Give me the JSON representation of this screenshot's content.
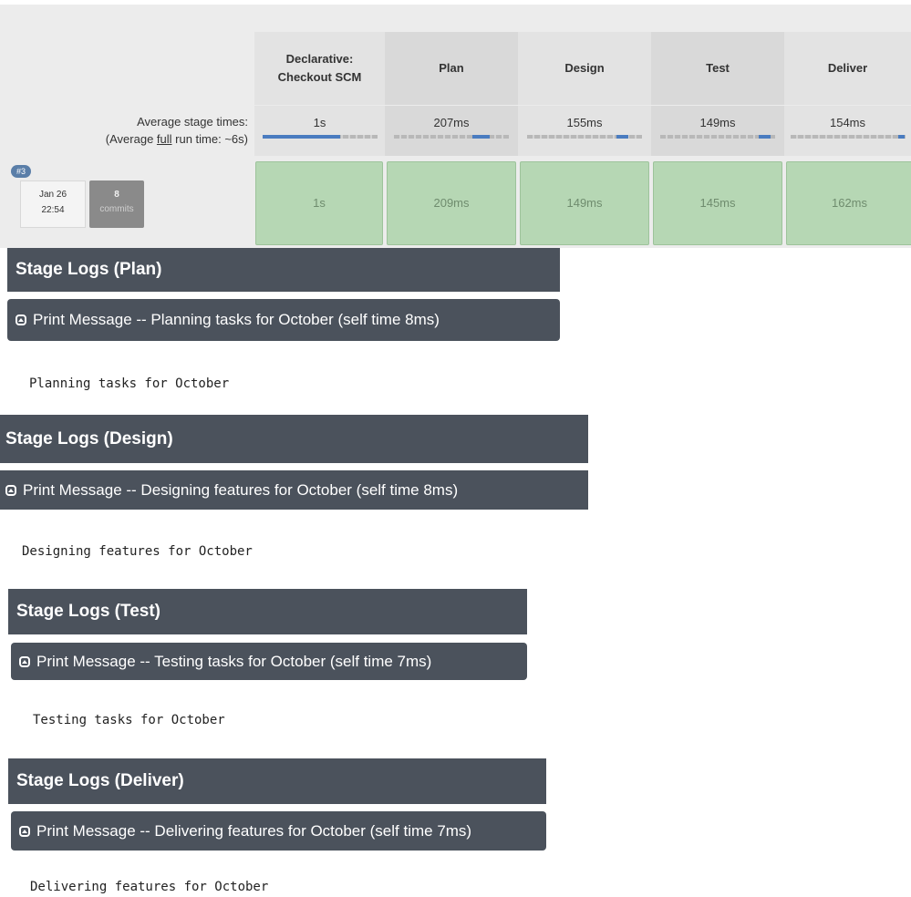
{
  "stage_view": {
    "columns": [
      {
        "name": "Declarative: Checkout SCM",
        "avg": "1s",
        "run": "1s",
        "bar_fill": 0.68
      },
      {
        "name": "Plan",
        "avg": "207ms",
        "run": "209ms",
        "bar_fill": 0.15
      },
      {
        "name": "Design",
        "avg": "155ms",
        "run": "149ms",
        "bar_fill": 0.1
      },
      {
        "name": "Test",
        "avg": "149ms",
        "run": "145ms",
        "bar_fill": 0.1
      },
      {
        "name": "Deliver",
        "avg": "154ms",
        "run": "162ms",
        "bar_fill": 0.1
      }
    ],
    "avg_stage_label": "Average stage times:",
    "avg_run_prefix": "(Average ",
    "avg_run_full": "full",
    "avg_run_suffix": " run time: ~6s)",
    "build": {
      "number": "#3",
      "date": "Jan 26",
      "time": "22:54",
      "commit_count": "8",
      "commit_label": "commits"
    },
    "colors": {
      "success_cell": "#b6d7b4",
      "bar_fill": "#4a7cc0",
      "header_dark": "#4b525c"
    }
  },
  "logs": [
    {
      "title": "Stage Logs (Plan)",
      "step": "Print Message -- Planning tasks for October (self time 8ms)",
      "output": "Planning tasks for October"
    },
    {
      "title": "Stage Logs (Design)",
      "step": "Print Message -- Designing features for October (self time 8ms)",
      "output": "Designing features for October"
    },
    {
      "title": "Stage Logs (Test)",
      "step": "Print Message -- Testing tasks for October (self time 7ms)",
      "output": "Testing tasks for October"
    },
    {
      "title": "Stage Logs (Deliver)",
      "step": "Print Message -- Delivering features for October (self time 7ms)",
      "output": "Delivering features for October"
    }
  ]
}
